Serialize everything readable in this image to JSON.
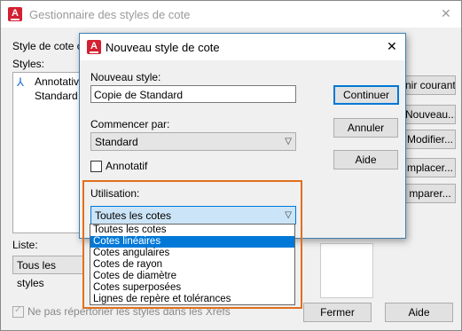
{
  "parent": {
    "title": "Gestionnaire des styles de cote",
    "current_style_label": "Style de cote co",
    "styles_label": "Styles:",
    "styles": [
      "Annotative",
      "Standard"
    ],
    "list_label": "Liste:",
    "list_value": "Tous les styles",
    "checkbox_label": "Ne pas répertorier les styles dans les Xrefs",
    "buttons": {
      "set_current": "nir courant",
      "new": "Nouveau...",
      "modify": "Modifier...",
      "replace": "mplacer...",
      "compare": "mparer...",
      "close": "Fermer",
      "help": "Aide"
    }
  },
  "dialog": {
    "title": "Nouveau style de cote",
    "new_style_label": "Nouveau style:",
    "new_style_value": "Copie de Standard",
    "start_with_label": "Commencer par:",
    "start_with_value": "Standard",
    "annotative_label": "Annotatif",
    "use_for_label": "Utilisation:",
    "use_for_value": "Toutes les cotes",
    "use_for_options": [
      "Toutes les cotes",
      "Cotes linéaires",
      "Cotes angulaires",
      "Cotes de rayon",
      "Cotes de diamètre",
      "Cotes superposées",
      "Lignes de repère et tolérances"
    ],
    "selected_option_index": 1,
    "buttons": {
      "continue": "Continuer",
      "cancel": "Annuler",
      "help": "Aide"
    }
  },
  "colors": {
    "highlight_frame": "#e0701d",
    "selection": "#0078d7",
    "app_logo": "#d32032"
  },
  "icons": {
    "app": "autocad-logo-icon",
    "close": "close-icon",
    "dropdown": "chevron-down-icon",
    "annotative": "annotative-icon"
  }
}
